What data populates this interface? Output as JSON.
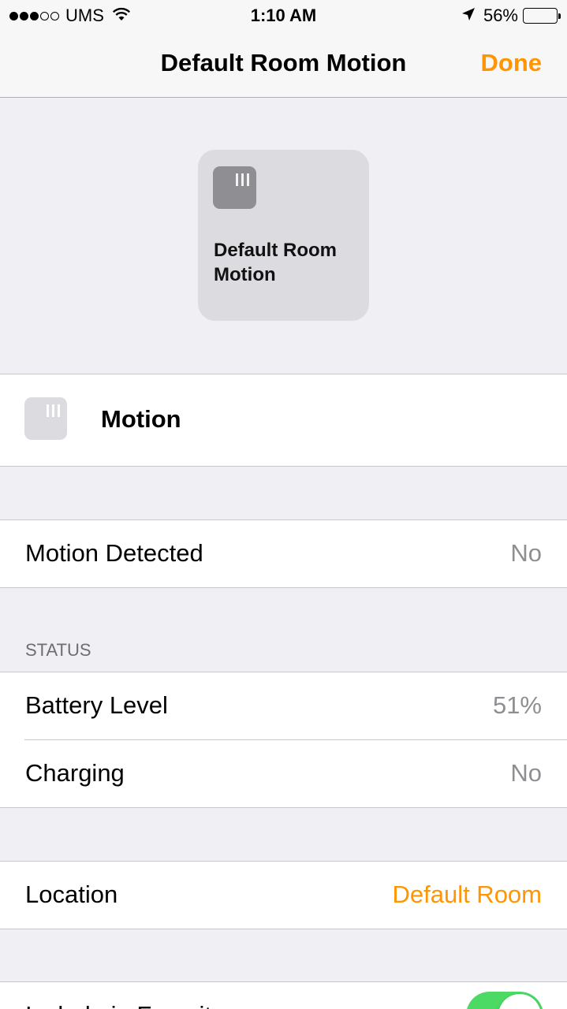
{
  "status_bar": {
    "carrier": "UMS",
    "time": "1:10 AM",
    "battery_percent": "56%",
    "battery_level": 0.56,
    "signal_bars_filled": 3,
    "signal_bars_total": 5
  },
  "nav": {
    "title": "Default Room Motion",
    "done_label": "Done"
  },
  "tile": {
    "icon": "motion-sensor-icon",
    "name": "Default Room Motion"
  },
  "service": {
    "icon": "motion-sensor-icon",
    "label": "Motion"
  },
  "motion_detected": {
    "label": "Motion Detected",
    "value": "No"
  },
  "status_section": {
    "header": "STATUS",
    "rows": [
      {
        "label": "Battery Level",
        "value": "51%"
      },
      {
        "label": "Charging",
        "value": "No"
      }
    ]
  },
  "location": {
    "label": "Location",
    "value": "Default Room"
  },
  "favorites": {
    "label": "Include in Favorites",
    "enabled": true
  },
  "colors": {
    "accent": "#ff9500",
    "toggle_on": "#4cd964",
    "background": "#efeff4"
  }
}
